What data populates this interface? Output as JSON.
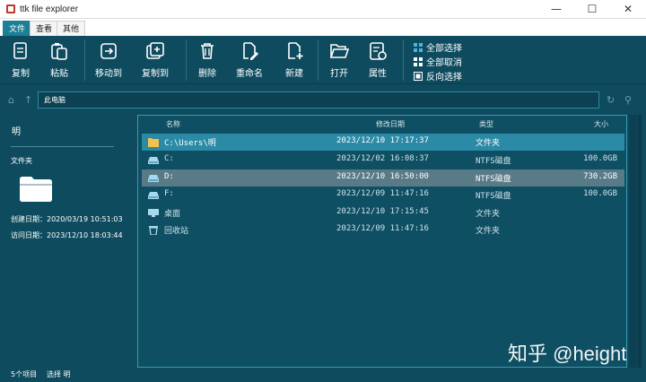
{
  "window": {
    "title": "ttk file explorer",
    "controls": [
      "—",
      "☐",
      "✕"
    ]
  },
  "menu_tabs": [
    {
      "label": "文件"
    },
    {
      "label": "查看"
    },
    {
      "label": "其他"
    }
  ],
  "ribbon": {
    "buttons": [
      {
        "label": "复制",
        "icon": "copy-icon"
      },
      {
        "label": "粘贴",
        "icon": "paste-icon"
      },
      {
        "label": "移动到",
        "icon": "move-icon"
      },
      {
        "label": "复制到",
        "icon": "copy-to-icon"
      },
      {
        "label": "删除",
        "icon": "trash-icon"
      },
      {
        "label": "重命名",
        "icon": "rename-icon"
      },
      {
        "label": "新建",
        "icon": "new-file-icon"
      },
      {
        "label": "打开",
        "icon": "open-folder-icon"
      },
      {
        "label": "属性",
        "icon": "properties-icon"
      }
    ],
    "small_buttons": [
      {
        "label": "全部选择",
        "icon": "select-all-icon"
      },
      {
        "label": "全部取消",
        "icon": "deselect-all-icon"
      },
      {
        "label": "反向选择",
        "icon": "invert-selection-icon"
      }
    ]
  },
  "address": {
    "path": "此电脑"
  },
  "details": {
    "title": "明",
    "kind": "文件夹",
    "created": "创建日期：2020/03/19 10:51:03",
    "accessed": "访问日期：2023/12/10 18:03:44"
  },
  "columns": {
    "name": "名称",
    "modified": "修改日期",
    "type": "类型",
    "size": "大小"
  },
  "files": [
    {
      "name": "C:\\Users\\明",
      "modified": "2023/12/10 17:17:37",
      "type": "文件夹",
      "size": "",
      "icon": "folder-icon"
    },
    {
      "name": "C:",
      "modified": "2023/12/02 16:08:37",
      "type": "NTFS磁盘",
      "size": "100.0GB",
      "icon": "drive-icon"
    },
    {
      "name": "D:",
      "modified": "2023/12/10 16:50:00",
      "type": "NTFS磁盘",
      "size": "730.2GB",
      "icon": "drive-icon"
    },
    {
      "name": "F:",
      "modified": "2023/12/09 11:47:16",
      "type": "NTFS磁盘",
      "size": "100.0GB",
      "icon": "drive-icon"
    },
    {
      "name": "桌面",
      "modified": "2023/12/10 17:15:45",
      "type": "文件夹",
      "size": "",
      "icon": "desktop-icon"
    },
    {
      "name": "回收站",
      "modified": "2023/12/09 11:47:16",
      "type": "文件夹",
      "size": "",
      "icon": "recycle-bin-icon"
    }
  ],
  "status": {
    "count": "5个项目",
    "selection": "选择 明"
  },
  "watermark": "知乎 @height",
  "colors": {
    "background": "#0e4b5e",
    "selected_row": "#2b8aa5",
    "hover_row": "#597b88",
    "accent_border": "#3a9ab2"
  }
}
